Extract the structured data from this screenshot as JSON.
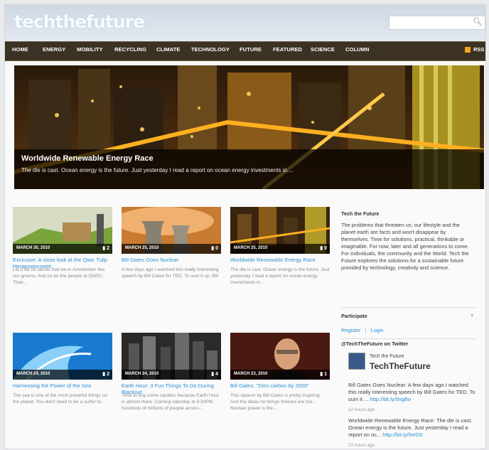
{
  "site": {
    "logo": "techthefuture",
    "search_placeholder": ""
  },
  "nav": {
    "items": [
      "HOME",
      "ENERGY",
      "MOBILITY",
      "RECYCLING",
      "CLIMATE",
      "TECHNOLOGY",
      "FUTURE",
      "FEATURED",
      "SCIENCE",
      "COLUMN"
    ],
    "rss": "RSS"
  },
  "hero": {
    "title": "Worldwide Renewable Energy Race",
    "excerpt": "The die is cast. Ocean energy is the future. Just yesterday I read a report on ocean energy investments in...."
  },
  "posts": [
    {
      "date": "MARCH 30, 2010",
      "comments": "2",
      "title": "Exclusive: A close look at the Qwic Tulip Herapowscooter",
      "excerpt": "Let it be no secret that we in Amsterdam like our greens. And so do the people at QWIC! Their..."
    },
    {
      "date": "MARCH 25, 2010",
      "comments": "0",
      "title": "Bill Gates Goes Nuclear",
      "excerpt": "A few days ago I watched this really interesting speech by Bill Gates for TED. To sum it up. Bill"
    },
    {
      "date": "MARCH 25, 2010",
      "comments": "0",
      "title": "Worldwide Renewable Energy Race",
      "excerpt": "The die is cast. Ocean energy is the future. Just yesterday I read a report on ocean energy investments in..."
    },
    {
      "date": "MARCH 24, 2010",
      "comments": "2",
      "title": "Harnessing the Power of the Sea",
      "excerpt": "The sea is one of the most powerful things on the planet. You don't need to be a surfer to..."
    },
    {
      "date": "MARCH 24, 2010",
      "comments": "4",
      "title": "Earth Hour: 3 Fun Things To Do During Blackout",
      "excerpt": "Time to buy some candles because Earth Hour is almost there. Coming saturday at 8:30PM hundreds of millions of people across..."
    },
    {
      "date": "MARCH 23, 2010",
      "comments": "1",
      "title": "Bill Gates: \"Zero carbon by 2050\"",
      "excerpt": "This speech by Bill Gates is pretty inspiring. And the ideas he brings forward are too... Nuclear power is the..."
    }
  ],
  "sidebar": {
    "about_title": "Tech the Future",
    "about_text": "The problems that threaten us; our lifestyle and the planet earth are facts and won't disappear by themselves. Time for solutions, practical, thinkable or imaginable. For now, later and all generations to come. For individuals, the community and the World. Tech the Future explores the solutions for a sustainable future provided by technology, creativity and science.",
    "participate_title": "Participate",
    "register": "Register",
    "separator": "|",
    "login": "Login",
    "twitter_title": "@TechTheFuture on Twitter",
    "twitter_account_small": "Tech the Future",
    "twitter_account": "TechTheFuture",
    "tweets": [
      {
        "text": "Bill Gates Goes Nuclear: A few days ago I watched this really interesting speech by Bill Gates for TED. To sum it ...",
        "link": "http://bit.ly/9vgBo",
        "ago": "12 hours ago"
      },
      {
        "text": "Worldwide Renewable Energy Race: The die is cast. Ocean energy is the future. Just yesterday I read a report on oc...",
        "link": "http://bit.ly/9xIO0",
        "ago": "13 hours ago"
      }
    ]
  }
}
